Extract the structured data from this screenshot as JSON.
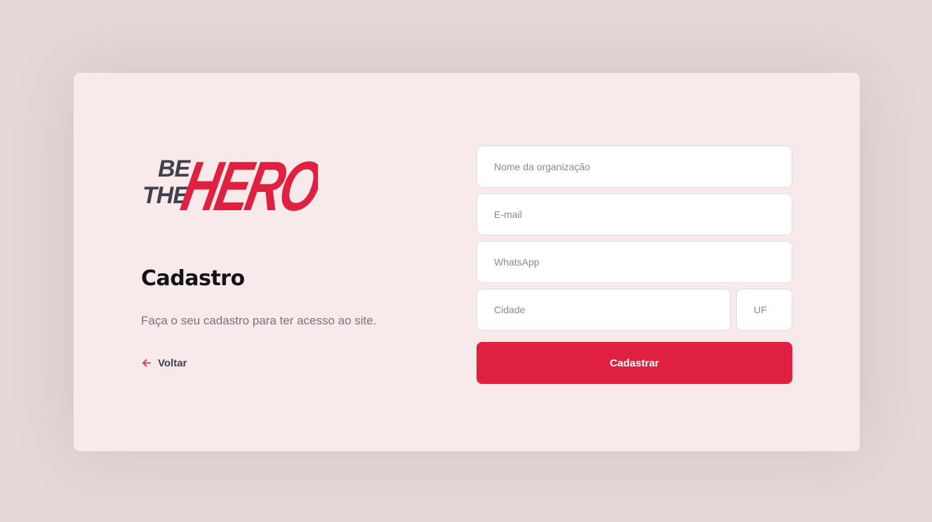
{
  "logo": {
    "alt": "Be The Hero",
    "line1": "BE",
    "line2": "THE",
    "word": "HERO",
    "dark_color": "#41414d",
    "brand_color": "#e02041"
  },
  "page": {
    "title": "Cadastro",
    "description": "Faça o seu cadastro para ter acesso ao site.",
    "back_label": "Voltar"
  },
  "form": {
    "name_placeholder": "Nome da organização",
    "email_placeholder": "E-mail",
    "whatsapp_placeholder": "WhatsApp",
    "city_placeholder": "Cidade",
    "uf_placeholder": "UF",
    "submit_label": "Cadastrar"
  },
  "colors": {
    "background": "#e5d8d8",
    "card": "#f8eaea",
    "accent": "#e02041"
  }
}
